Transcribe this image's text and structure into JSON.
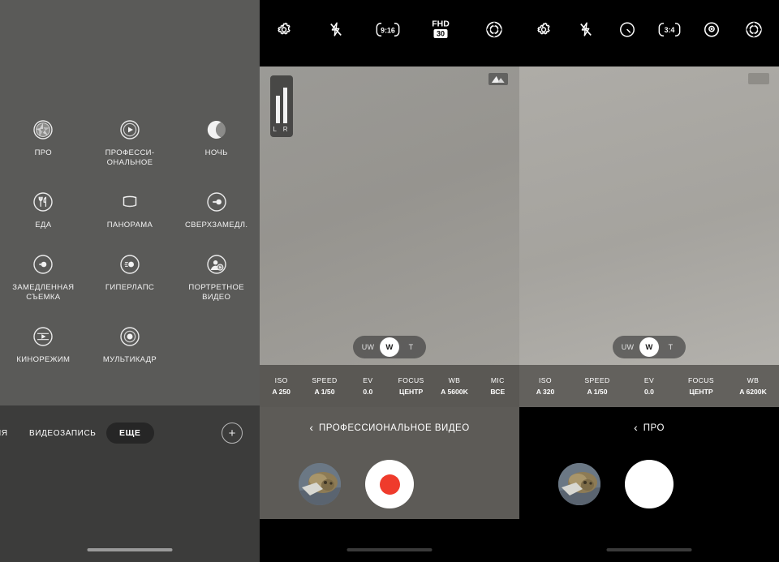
{
  "panel_mode_picker": {
    "modes": [
      {
        "label": "ПРО",
        "icon": "aperture-icon"
      },
      {
        "label": "ПРОФЕССИ-ОНАЛЬНОЕ",
        "icon": "pro-video-icon"
      },
      {
        "label": "НОЧЬ",
        "icon": "moon-icon"
      },
      {
        "label": "ЕДА",
        "icon": "food-icon"
      },
      {
        "label": "ПАНОРАМА",
        "icon": "panorama-icon"
      },
      {
        "label": "СВЕРХЗАМЕДЛ.",
        "icon": "super-slow-motion-icon"
      },
      {
        "label": "ЗАМЕДЛЕННАЯ СЪЕМКА",
        "icon": "slow-motion-icon"
      },
      {
        "label": "ГИПЕРЛАПС",
        "icon": "hyperlapse-icon"
      },
      {
        "label": "ПОРТРЕТНОЕ ВИДЕО",
        "icon": "portrait-video-icon"
      },
      {
        "label": "КИНОРЕЖИМ",
        "icon": "cinema-mode-icon"
      },
      {
        "label": "МУЛЬТИКАДР",
        "icon": "multi-frame-icon"
      }
    ],
    "mode_bar": {
      "cut_label": "ИЯ",
      "video_label": "ВИДЕОЗАПИСЬ",
      "more_label": "ЕЩЕ",
      "add_label": "+"
    }
  },
  "panel_pro_video": {
    "toolbar": [
      {
        "icon": "gear-icon",
        "label": ""
      },
      {
        "icon": "flash-off-icon",
        "label": ""
      },
      {
        "icon": "aspect-ratio-icon",
        "label": "9:16"
      },
      {
        "icon": "resolution-icon",
        "label": "FHD",
        "sub": "30"
      },
      {
        "icon": "filter-icon",
        "label": ""
      }
    ],
    "audio_meter": {
      "label": "L R"
    },
    "scene_icon": "scene-optimizer-icon",
    "zoom": {
      "options": [
        "UW",
        "W",
        "T"
      ],
      "selected": "W"
    },
    "pro_settings": [
      {
        "key": "ISO",
        "value": "A 250"
      },
      {
        "key": "SPEED",
        "value": "A 1/50"
      },
      {
        "key": "EV",
        "value": "0.0"
      },
      {
        "key": "FOCUS",
        "value": "ЦЕНТР"
      },
      {
        "key": "WB",
        "value": "A 5600K"
      },
      {
        "key": "MIC",
        "value": "ВСЕ"
      }
    ],
    "mode_title": {
      "back": "‹",
      "text": "ПРОФЕССИОНАЛЬНОЕ ВИДЕО"
    },
    "shutter": {
      "type": "record",
      "color": "#ef3b2c"
    },
    "thumbnail": "gallery-thumbnail"
  },
  "panel_pro_photo": {
    "toolbar": [
      {
        "icon": "gear-icon",
        "label": ""
      },
      {
        "icon": "flash-off-icon",
        "label": ""
      },
      {
        "icon": "timer-icon",
        "label": ""
      },
      {
        "icon": "aspect-ratio-icon",
        "label": "3:4"
      },
      {
        "icon": "metering-icon",
        "label": ""
      },
      {
        "icon": "filter-icon",
        "label": ""
      }
    ],
    "scene_icon": "scene-optimizer-icon",
    "zoom": {
      "options": [
        "UW",
        "W",
        "T"
      ],
      "selected": "W"
    },
    "pro_settings": [
      {
        "key": "ISO",
        "value": "A 320"
      },
      {
        "key": "SPEED",
        "value": "A 1/50"
      },
      {
        "key": "EV",
        "value": "0.0"
      },
      {
        "key": "FOCUS",
        "value": "ЦЕНТР"
      },
      {
        "key": "WB",
        "value": "A 6200K"
      }
    ],
    "mode_title": {
      "back": "‹",
      "text": "ПРО"
    },
    "shutter": {
      "type": "photo",
      "color": "#ffffff"
    },
    "thumbnail": "gallery-thumbnail"
  },
  "colors": {
    "panel1_bg": "#5a5a58",
    "panel1_bottom": "#3c3c3b",
    "toolbar_bg": "#000000",
    "record_red": "#ef3b2c",
    "accent_white": "#ffffff"
  }
}
